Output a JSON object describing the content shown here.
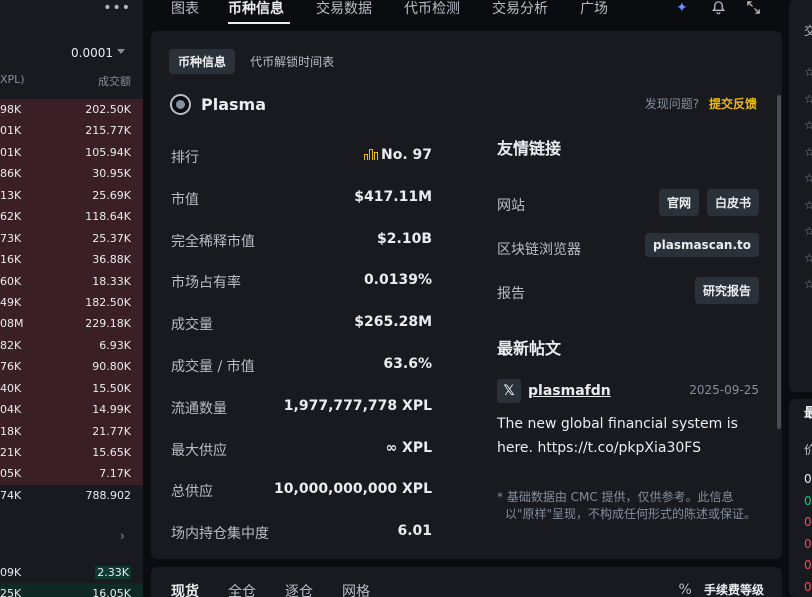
{
  "orderbook": {
    "menu_glyph": "•••",
    "precision": "0.0001",
    "header_left": "XPL)",
    "header_right": "成交额",
    "asks": [
      [
        "98K",
        "202.50K"
      ],
      [
        "01K",
        "215.77K"
      ],
      [
        "01K",
        "105.94K"
      ],
      [
        "86K",
        "30.95K"
      ],
      [
        "13K",
        "25.69K"
      ],
      [
        "62K",
        "118.64K"
      ],
      [
        "73K",
        "25.37K"
      ],
      [
        "16K",
        "36.88K"
      ],
      [
        "60K",
        "18.33K"
      ],
      [
        "49K",
        "182.50K"
      ],
      [
        "08M",
        "229.18K"
      ],
      [
        "82K",
        "6.93K"
      ],
      [
        "76K",
        "90.80K"
      ],
      [
        "40K",
        "15.50K"
      ],
      [
        "04K",
        "14.99K"
      ],
      [
        "18K",
        "21.77K"
      ],
      [
        "21K",
        "15.65K"
      ],
      [
        "05K",
        "7.17K"
      ]
    ],
    "total": [
      "74K",
      "788.902"
    ],
    "bids": [
      [
        "09K",
        "2.33K"
      ],
      [
        "25K",
        "16.05K"
      ]
    ]
  },
  "nav": {
    "tabs": [
      "图表",
      "币种信息",
      "交易数据",
      "代币检测",
      "交易分析",
      "广场"
    ],
    "active_index": 1
  },
  "subtabs": [
    "币种信息",
    "代币解锁时间表"
  ],
  "coin": {
    "name": "Plasma"
  },
  "feedback": {
    "question": "发现问题?",
    "link": "提交反馈"
  },
  "stats": [
    {
      "k": "排行",
      "v": "No. 97"
    },
    {
      "k": "市值",
      "v": "$417.11M"
    },
    {
      "k": "完全稀释市值",
      "v": "$2.10B"
    },
    {
      "k": "市场占有率",
      "v": "0.0139%"
    },
    {
      "k": "成交量",
      "v": "$265.28M"
    },
    {
      "k": "成交量 / 市值",
      "v": "63.6%"
    },
    {
      "k": "流通数量",
      "v": "1,977,777,778 XPL"
    },
    {
      "k": "最大供应",
      "v": "∞ XPL"
    },
    {
      "k": "总供应",
      "v": "10,000,000,000 XPL"
    },
    {
      "k": "场内持仓集中度",
      "v": "6.01"
    }
  ],
  "links": {
    "title": "友情链接",
    "rows": [
      {
        "k": "网站",
        "btns": [
          "官网",
          "白皮书"
        ]
      },
      {
        "k": "区块链浏览器",
        "btns": [
          "plasmascan.to"
        ]
      },
      {
        "k": "报告",
        "btns": [
          "研究报告"
        ]
      }
    ]
  },
  "posts": {
    "title": "最新帖文",
    "x_glyph": "𝕏",
    "handle": "plasmafdn",
    "date": "2025-09-25",
    "text": "The new global financial system is here. https://t.co/pkpXia30FS"
  },
  "note": "* 基础数据由 CMC 提供，仅供参考。此信息以\"原样\"呈现，不构成任何形式的陈述或保证。",
  "bottom": {
    "tabs": [
      "现货",
      "全仓",
      "逐仓",
      "网格"
    ],
    "fee_icon": "%",
    "fee_label": "手续费等级"
  },
  "right_strip": {
    "top_label": "交",
    "section_label": "最",
    "sub_label": "价",
    "numbers": [
      "0",
      "0",
      "0",
      "0",
      "0",
      "0",
      "0"
    ],
    "colors": [
      "#eaecef",
      "#0ecb81",
      "#f6465d",
      "#f6465d",
      "#f6465d",
      "#f6465d",
      "#f6465d"
    ]
  }
}
